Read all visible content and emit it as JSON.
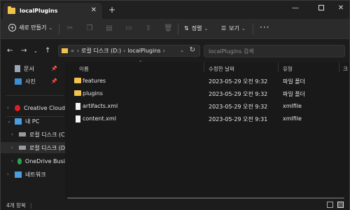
{
  "titlebar": {
    "tab_title": "localPlugins",
    "close_glyph": "✕",
    "newtab_glyph": "+",
    "min_glyph": "—",
    "close_window_glyph": "✕"
  },
  "toolbar": {
    "new_label": "새로 만들기",
    "sort_label": "정렬",
    "view_label": "보기",
    "more_label": "···",
    "icons": [
      "cut-icon",
      "copy-icon",
      "paste-icon",
      "rename-icon",
      "share-icon",
      "delete-icon"
    ]
  },
  "address": {
    "overflow": "«",
    "crumbs": [
      "로컬 디스크 (D:)",
      "localPlugins"
    ],
    "search_placeholder": "localPlugins 검색"
  },
  "sidebar": {
    "pinned": [
      {
        "label": "문서",
        "icon": "documents-icon"
      },
      {
        "label": "사진",
        "icon": "pictures-icon"
      }
    ],
    "tree": [
      {
        "label": "Creative Cloud",
        "icon": "creative-cloud-icon",
        "expand": "›"
      },
      {
        "label": "내 PC",
        "icon": "pc-icon",
        "expand": "⌄"
      },
      {
        "label": "로컬 디스크 (C",
        "icon": "drive-icon",
        "expand": "›"
      },
      {
        "label": "로컬 디스크 (D",
        "icon": "drive-icon",
        "expand": "›"
      },
      {
        "label": "OneDrive Busi",
        "icon": "onedrive-icon",
        "expand": "›"
      },
      {
        "label": "네트워크",
        "icon": "network-icon",
        "expand": "›"
      }
    ]
  },
  "columns": {
    "name": "이름",
    "modified": "수정한 날짜",
    "type": "유형",
    "size": "크"
  },
  "files": [
    {
      "name": "features",
      "modified": "2023-05-29 오전 9:32",
      "type": "파일 폴더",
      "kind": "folder"
    },
    {
      "name": "plugins",
      "modified": "2023-05-29 오전 9:32",
      "type": "파일 폴더",
      "kind": "folder"
    },
    {
      "name": "artifacts.xml",
      "modified": "2023-05-29 오전 9:32",
      "type": "xmlfile",
      "kind": "file"
    },
    {
      "name": "content.xml",
      "modified": "2023-05-29 오전 9:31",
      "type": "xmlfile",
      "kind": "file"
    }
  ],
  "status": {
    "count": "4개 항목",
    "divider": "|"
  },
  "colors": {
    "folder": "#f2c14e",
    "background": "#191919",
    "accent": "#2b2b2b"
  }
}
